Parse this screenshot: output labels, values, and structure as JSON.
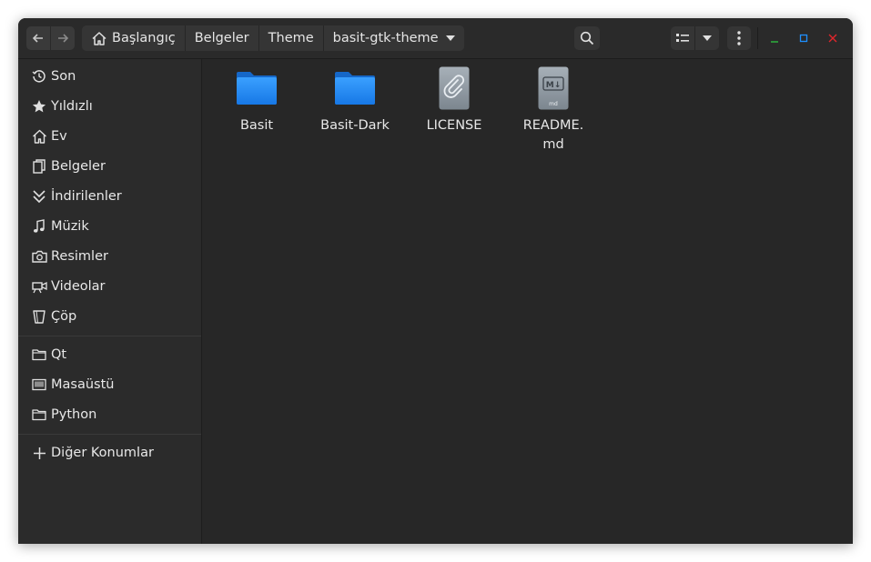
{
  "pathbar": {
    "crumbs": [
      "Başlangıç",
      "Belgeler",
      "Theme",
      "basit-gtk-theme"
    ]
  },
  "icons": {
    "back": "arrow-left-icon",
    "forward": "arrow-right-icon",
    "home": "home-icon",
    "dropdown": "chevron-down-icon",
    "search": "search-icon",
    "view_list": "list-view-icon",
    "view_options": "chevron-down-icon",
    "menu": "kebab-menu-icon",
    "minimize": "minimize-icon",
    "maximize": "maximize-icon",
    "close": "close-icon"
  },
  "window_controls": {
    "minimize_color": "#2ecc40",
    "maximize_color": "#1e90ff",
    "close_color": "#e0262c"
  },
  "sidebar": {
    "places": [
      {
        "label": "Son",
        "icon": "recent-icon"
      },
      {
        "label": "Yıldızlı",
        "icon": "star-icon"
      },
      {
        "label": "Ev",
        "icon": "home-icon"
      },
      {
        "label": "Belgeler",
        "icon": "documents-icon"
      },
      {
        "label": "İndirilenler",
        "icon": "downloads-icon"
      },
      {
        "label": "Müzik",
        "icon": "music-icon"
      },
      {
        "label": "Resimler",
        "icon": "camera-icon"
      },
      {
        "label": "Videolar",
        "icon": "video-icon"
      },
      {
        "label": "Çöp",
        "icon": "trash-icon"
      }
    ],
    "bookmarks": [
      {
        "label": "Qt",
        "icon": "folder-icon"
      },
      {
        "label": "Masaüstü",
        "icon": "desktop-icon"
      },
      {
        "label": "Python",
        "icon": "folder-icon"
      }
    ],
    "other": {
      "label": "Diğer Konumlar",
      "icon": "plus-icon"
    }
  },
  "files": [
    {
      "name": "Basit",
      "type": "folder",
      "icon": "folder-icon"
    },
    {
      "name": "Basit-Dark",
      "type": "folder",
      "icon": "folder-icon"
    },
    {
      "name": "LICENSE",
      "type": "file",
      "icon": "license-file-icon"
    },
    {
      "name": "README.\nmd",
      "type": "file",
      "icon": "markdown-file-icon",
      "badge": "M↓",
      "ext": "md"
    }
  ],
  "colors": {
    "folder_top": "#3aa0ff",
    "folder_bottom": "#1778e6",
    "window_bg": "#272727",
    "sidebar_bg": "#2b2b2b",
    "text": "#e8e8e8"
  }
}
